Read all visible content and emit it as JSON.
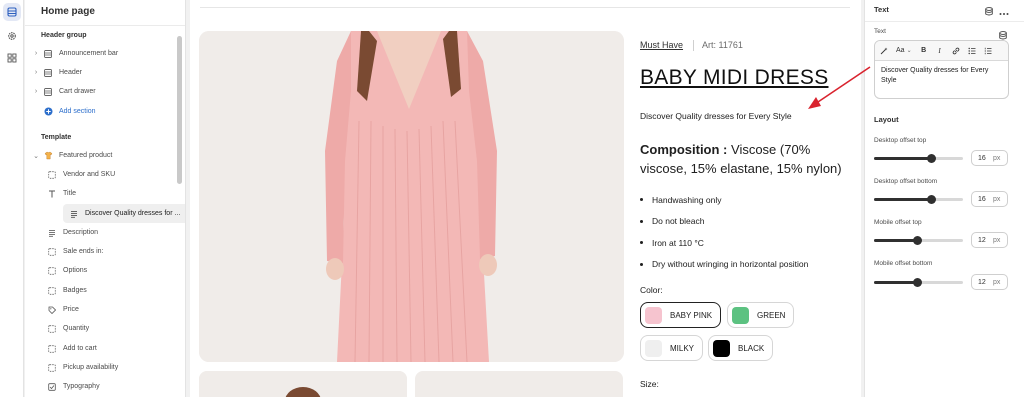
{
  "left_panel": {
    "title": "Home page",
    "header_group": {
      "title": "Header group",
      "items": [
        {
          "label": "Announcement bar",
          "icon": "section-icon"
        },
        {
          "label": "Header",
          "icon": "section-icon"
        },
        {
          "label": "Cart drawer",
          "icon": "section-icon"
        }
      ],
      "add_label": "Add section"
    },
    "template": {
      "title": "Template",
      "section_label": "Featured product",
      "blocks": [
        {
          "label": "Vendor and SKU",
          "icon": "block-icon"
        },
        {
          "label": "Title",
          "icon": "title-icon"
        },
        {
          "label": "Discover Quality dresses for ...",
          "icon": "text-icon"
        },
        {
          "label": "Description",
          "icon": "text-icon"
        },
        {
          "label": "Sale ends in:",
          "icon": "block-icon"
        },
        {
          "label": "Options",
          "icon": "block-icon"
        },
        {
          "label": "Badges",
          "icon": "block-icon"
        },
        {
          "label": "Price",
          "icon": "price-tag-icon"
        },
        {
          "label": "Quantity",
          "icon": "block-icon"
        },
        {
          "label": "Add to cart",
          "icon": "block-icon"
        },
        {
          "label": "Pickup availability",
          "icon": "block-icon"
        },
        {
          "label": "Typography",
          "icon": "checkbox-icon"
        }
      ]
    }
  },
  "product": {
    "vendor": "Must Have",
    "sku": "Art: 11761",
    "title": "BABY MIDI DRESS",
    "subtitle": "Discover Quality dresses for Every Style",
    "composition_label": "Composition :",
    "composition_value": " Viscose (70% viscose, 15% elastane, 15% nylon)",
    "care": [
      "Handwashing only",
      "Do not bleach",
      "Iron at 110 °C",
      "Dry without wringing in horizontal position"
    ],
    "color_label": "Color:",
    "colors": [
      {
        "name": "BABY PINK",
        "hex": "#f6c4cf",
        "selected": true
      },
      {
        "name": "GREEN",
        "hex": "#5cc281",
        "selected": false
      },
      {
        "name": "MILKY",
        "hex": "#efefef",
        "selected": false
      },
      {
        "name": "BLACK",
        "hex": "#000000",
        "selected": false
      }
    ],
    "size_label": "Size:"
  },
  "right_panel": {
    "title": "Text",
    "text_label": "Text",
    "toolbar": {
      "font_size": "Aa",
      "bold": "B",
      "italic": "I"
    },
    "text_value": "Discover Quality dresses for Every Style",
    "layout_title": "Layout",
    "sliders": [
      {
        "label": "Desktop offset top",
        "value": "16",
        "unit": "px",
        "fraction": 0.64
      },
      {
        "label": "Desktop offset bottom",
        "value": "16",
        "unit": "px",
        "fraction": 0.64
      },
      {
        "label": "Mobile offset top",
        "value": "12",
        "unit": "px",
        "fraction": 0.48
      },
      {
        "label": "Mobile offset bottom",
        "value": "12",
        "unit": "px",
        "fraction": 0.48
      }
    ]
  },
  "colors": {
    "accent_blue": "#2c6ecb",
    "annotation_red": "#d9232e",
    "dress_pink": "#f3b8b6"
  }
}
